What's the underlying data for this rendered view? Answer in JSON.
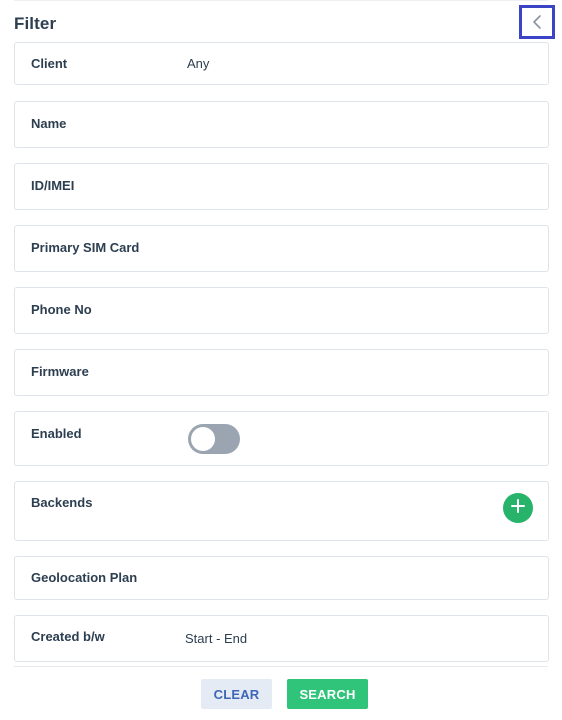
{
  "header": {
    "title": "Filter",
    "collapse_icon": "chevron-left-icon"
  },
  "fields": {
    "client": {
      "label": "Client",
      "value": "Any"
    },
    "name": {
      "label": "Name"
    },
    "id_imei": {
      "label": "ID/IMEI"
    },
    "primary_sim": {
      "label": "Primary SIM Card"
    },
    "phone_no": {
      "label": "Phone No"
    },
    "firmware": {
      "label": "Firmware"
    },
    "enabled": {
      "label": "Enabled",
      "toggle_on": false
    },
    "backends": {
      "label": "Backends",
      "add_icon": "plus-circle-icon"
    },
    "geolocation_plan": {
      "label": "Geolocation Plan"
    },
    "created_bw": {
      "label": "Created b/w",
      "value": "Start - End"
    }
  },
  "actions": {
    "clear_label": "CLEAR",
    "search_label": "SEARCH"
  },
  "colors": {
    "highlight_border": "#3a44c4",
    "toggle_off": "#9aa5b1",
    "add_green": "#27b36a",
    "search_green": "#2fc47a",
    "clear_bg": "#e4ebf5",
    "clear_text": "#3e67b8"
  }
}
